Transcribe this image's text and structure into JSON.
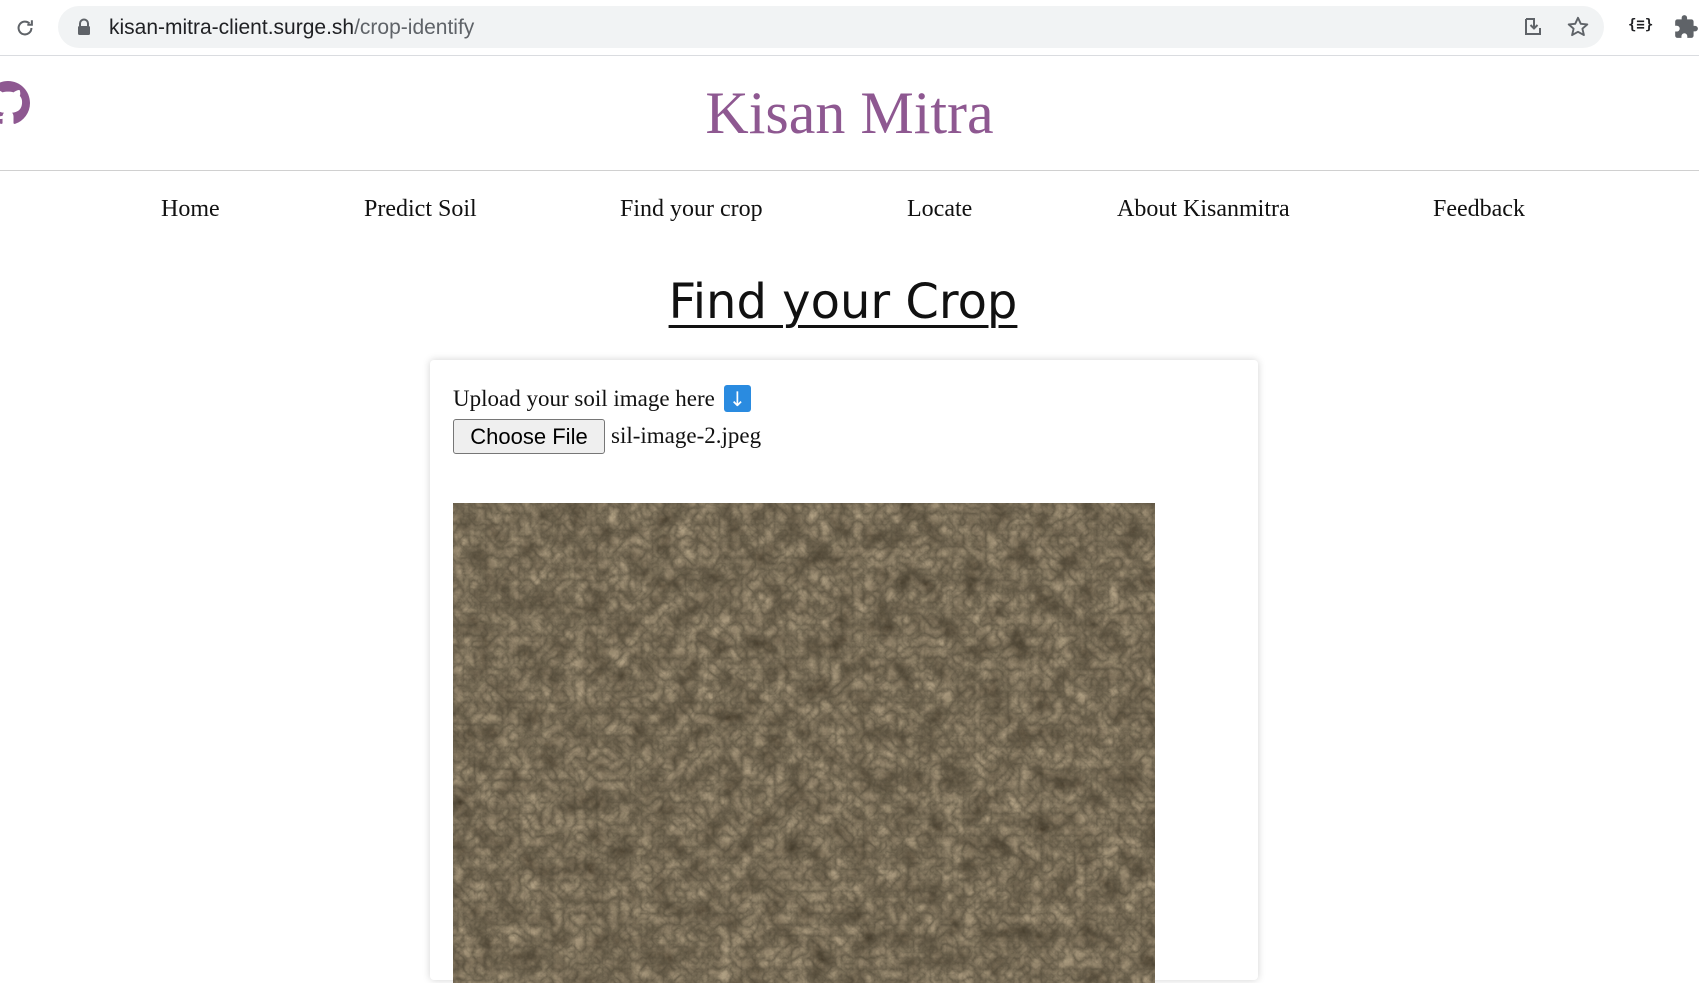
{
  "browser": {
    "url_host": "kisan-mitra-client.surge.sh",
    "url_path": "/crop-identify"
  },
  "site": {
    "brand": "Kisan Mitra"
  },
  "nav": {
    "items": [
      "Home",
      "Predict Soil",
      "Find your crop",
      "Locate",
      "About Kisanmitra",
      "Feedback"
    ]
  },
  "main": {
    "title": "Find your Crop",
    "upload_label": "Upload your soil image here",
    "upload_arrow": "↓",
    "choose_file_label": "Choose File",
    "selected_file": "sil-image-2.jpeg"
  },
  "colors": {
    "brand": "#8e5891",
    "arrow_badge": "#2a8be0"
  }
}
